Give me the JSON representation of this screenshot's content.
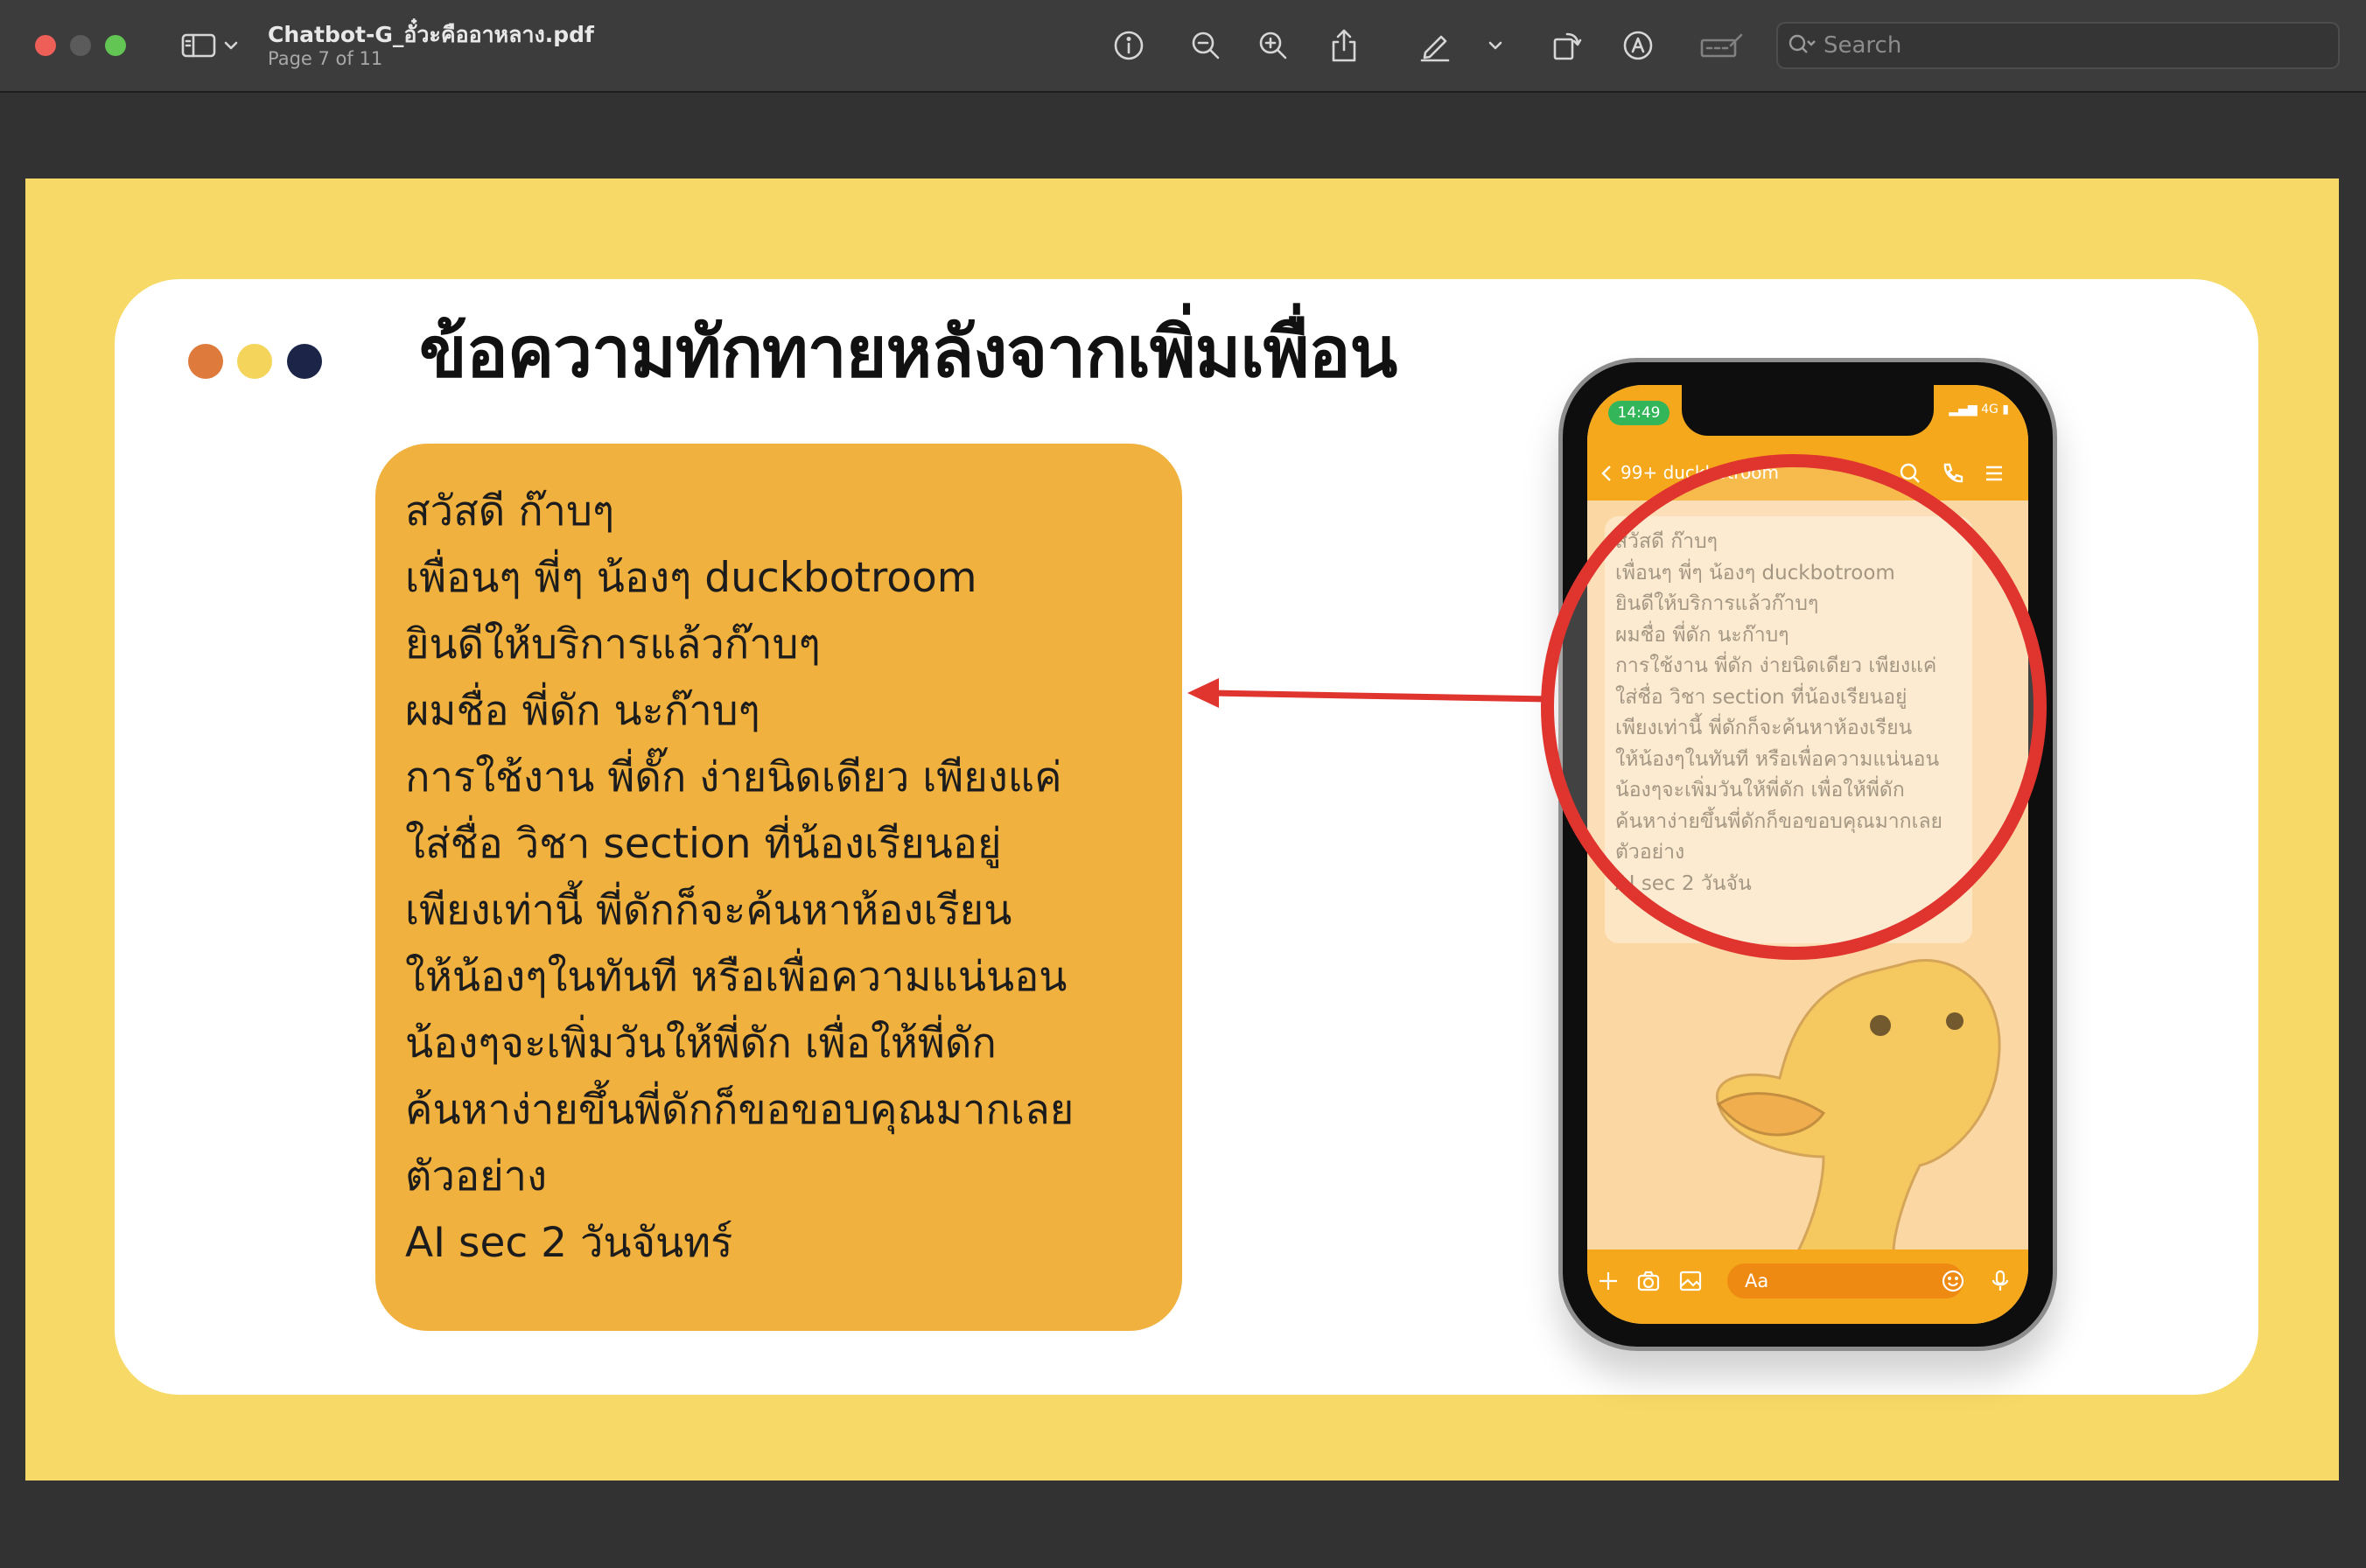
{
  "window": {
    "title": "Chatbot-G_อั๋วะคืออาหลาง.pdf",
    "subtitle": "Page 7 of 11",
    "search_placeholder": "Search"
  },
  "colors": {
    "page_bg": "#f7d967",
    "card_bg": "#ffffff",
    "message_box": "#f0b13f",
    "accent_red": "#e0342f",
    "dot_orange": "#dd7a3c",
    "dot_yellow": "#f4d45a",
    "dot_navy": "#1c2548"
  },
  "slide": {
    "title": "ข้อความทักทายหลังจากเพิ่มเพื่อน",
    "message_lines": [
      "สวัสดี ก๊าบๆ",
      "เพื่อนๆ พี่ๆ น้องๆ duckbotroom",
      "ยินดีให้บริการแล้วก๊าบๆ",
      "ผมชื่อ พี่ดัก นะก๊าบๆ",
      "การใช้งาน พี่ดั๊ก ง่ายนิดเดียว เพียงแค่",
      "ใส่ชื่อ วิชา section ที่น้องเรียนอยู่",
      "เพียงเท่านี้ พี่ดักก็จะค้นหาห้องเรียน",
      "ให้น้องๆในทันที หรือเพื่อความแน่นอน",
      "น้องๆจะเพิ่มวันให้พี่ดัก เพื่อให้พี่ดัก",
      "ค้นหาง่ายขึ้นพี่ดักก็ขอขอบคุณมากเลย",
      "ตัวอย่าง",
      "AI sec 2 วันจันทร์"
    ]
  },
  "phone": {
    "time": "14:49",
    "network": "4G",
    "chat_title": "99+ duckbotroom",
    "input_placeholder": "Aa",
    "bubble_lines": [
      "สวัสดี ก๊าบๆ",
      "เพื่อนๆ พี่ๆ น้องๆ duckbotroom",
      "ยินดีให้บริการแล้วก๊าบๆ",
      "ผมชื่อ พี่ดัก นะก๊าบๆ",
      "การใช้งาน พี่ดัก ง่ายนิดเดียว เพียงแค่",
      "ใส่ชื่อ วิชา section ที่น้องเรียนอยู่",
      "เพียงเท่านี้ พี่ดักก็จะค้นหาห้องเรียน",
      "ให้น้องๆในทันที หรือเพื่อความแน่นอน",
      "น้องๆจะเพิ่มวันให้พี่ดัก เพื่อให้พี่ดัก",
      "ค้นหาง่ายขึ้นพี่ดักก็ขอขอบคุณมากเลย",
      "ตัวอย่าง",
      "AI sec 2 วันจัน"
    ]
  },
  "icons": {
    "sidebar": "sidebar-icon",
    "info": "info-icon",
    "zoom_out": "zoom-out-icon",
    "zoom_in": "zoom-in-icon",
    "share": "share-icon",
    "markup": "pencil-icon",
    "rotate": "rotate-icon",
    "annotate": "annotate-icon",
    "form_fill": "form-fill-icon",
    "search": "search-icon"
  }
}
